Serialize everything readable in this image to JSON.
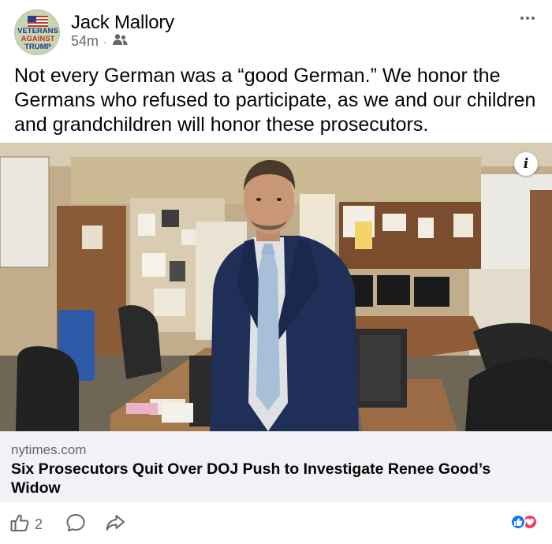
{
  "header": {
    "avatar_text": [
      "VETERANS",
      "AGAINST",
      "TRUMP"
    ],
    "author": "Jack Mallory",
    "time": "54m",
    "separator": "·",
    "audience_icon": "friends-icon",
    "more_icon": "more-horizontal-icon"
  },
  "post": {
    "text": "Not every German was a “good German.” We honor the Germans who refused to participate, as we and our children and grandchildren will honor these prosecutors."
  },
  "photo": {
    "info_label": "i"
  },
  "link": {
    "domain": "nytimes.com",
    "title": "Six Prosecutors Quit Over DOJ Push to Investigate Renee Good’s Widow"
  },
  "actions": {
    "like_count": "2",
    "like_icon": "thumbs-up-outline-icon",
    "comment_icon": "comment-icon",
    "share_icon": "share-icon"
  },
  "colors": {
    "text": "#050505",
    "secondary": "#65676b",
    "link_card_bg": "#f0f2f5",
    "like_blue": "#1877f2",
    "love_red": "#f33e58"
  }
}
